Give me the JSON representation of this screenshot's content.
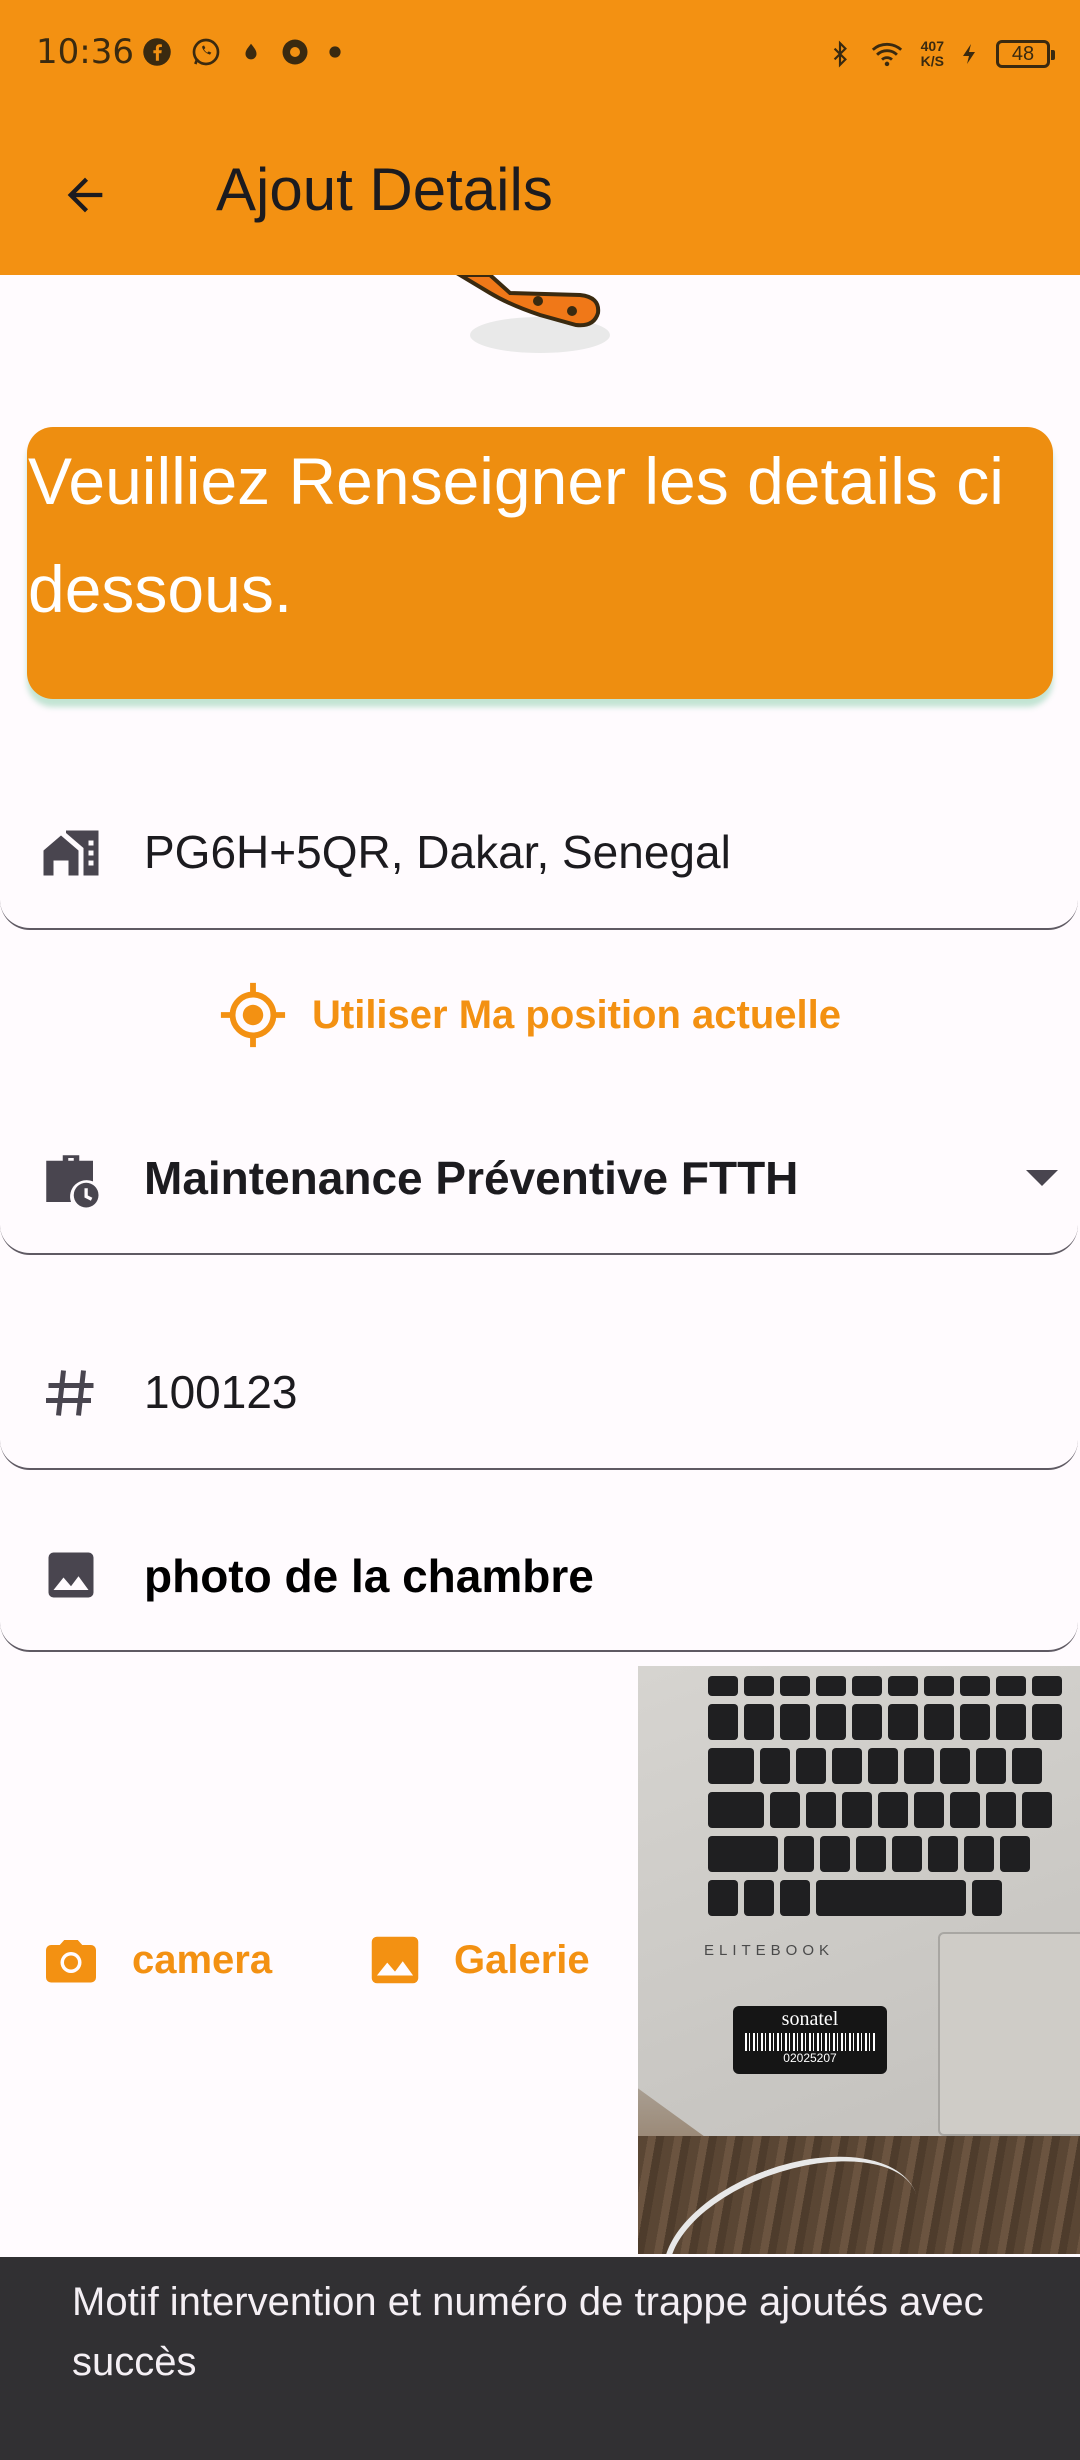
{
  "status_bar": {
    "time": "10:36",
    "speed_value": "407",
    "speed_unit": "K/S",
    "battery": "48"
  },
  "app_bar": {
    "title": "Ajout Details"
  },
  "banner": {
    "text": "Veuilliez Renseigner les details ci dessous."
  },
  "form": {
    "address": "PG6H+5QR, Dakar, Senegal",
    "use_position_label": "Utiliser Ma position actuelle",
    "intervention_type": "Maintenance Préventive FTTH",
    "number": "100123",
    "photo_label": "photo de la chambre",
    "camera_label": "camera",
    "gallery_label": "Galerie"
  },
  "photo_preview": {
    "brand_text": "ELITEBOOK",
    "sticker_brand": "sonatel",
    "sticker_code": "02025207"
  },
  "snackbar": {
    "message": "Motif intervention et numéro de trappe ajoutés avec succès"
  },
  "colors": {
    "primary": "#f39112",
    "banner": "#ee8e10",
    "snackbar": "#313033",
    "background": "#fffbfe"
  }
}
